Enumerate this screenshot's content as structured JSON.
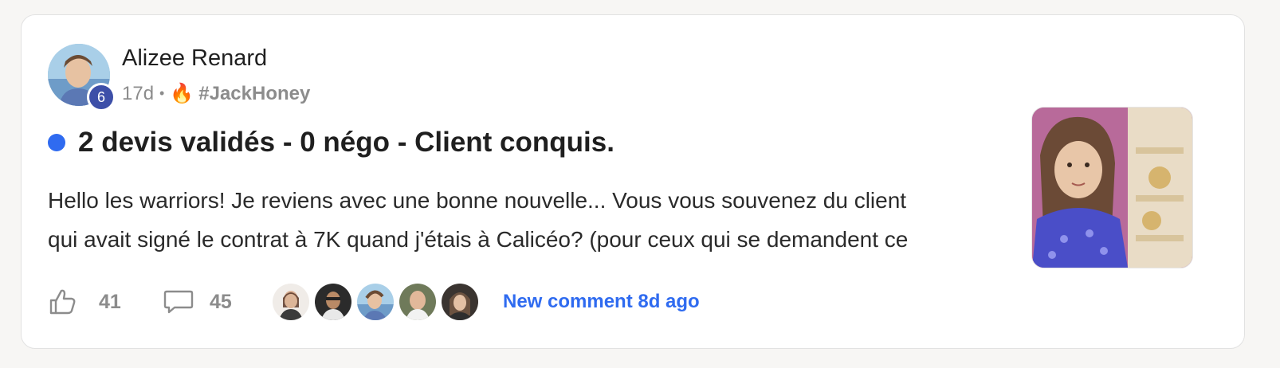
{
  "post": {
    "author": {
      "name": "Alizee Renard",
      "level": "6",
      "level_badge_color": "#3d4fa8"
    },
    "meta": {
      "age": "17d",
      "separator": "•",
      "channel_icon": "fire-icon",
      "channel_emoji": "🔥",
      "channel": "#JackHoney"
    },
    "unread_dot_color": "#2f6bf0",
    "title": "2 devis validés - 0 négo - Client conquis.",
    "body": "Hello les warriors! Je reviens avec une bonne nouvelle... Vous vous souvenez du client\nqui avait signé le contrat à 7K quand j'étais à Calicéo? (pour ceux qui se demandent ce",
    "footer": {
      "likes": "41",
      "like_icon": "thumbs-up-icon",
      "comments": "45",
      "comment_icon": "comment-bubble-icon",
      "commenter_avatars": [
        "avatar-1",
        "avatar-2",
        "avatar-3",
        "avatar-4",
        "avatar-5"
      ],
      "new_comment_label": "New comment 8d ago",
      "accent_color": "#2f6bf0"
    }
  }
}
